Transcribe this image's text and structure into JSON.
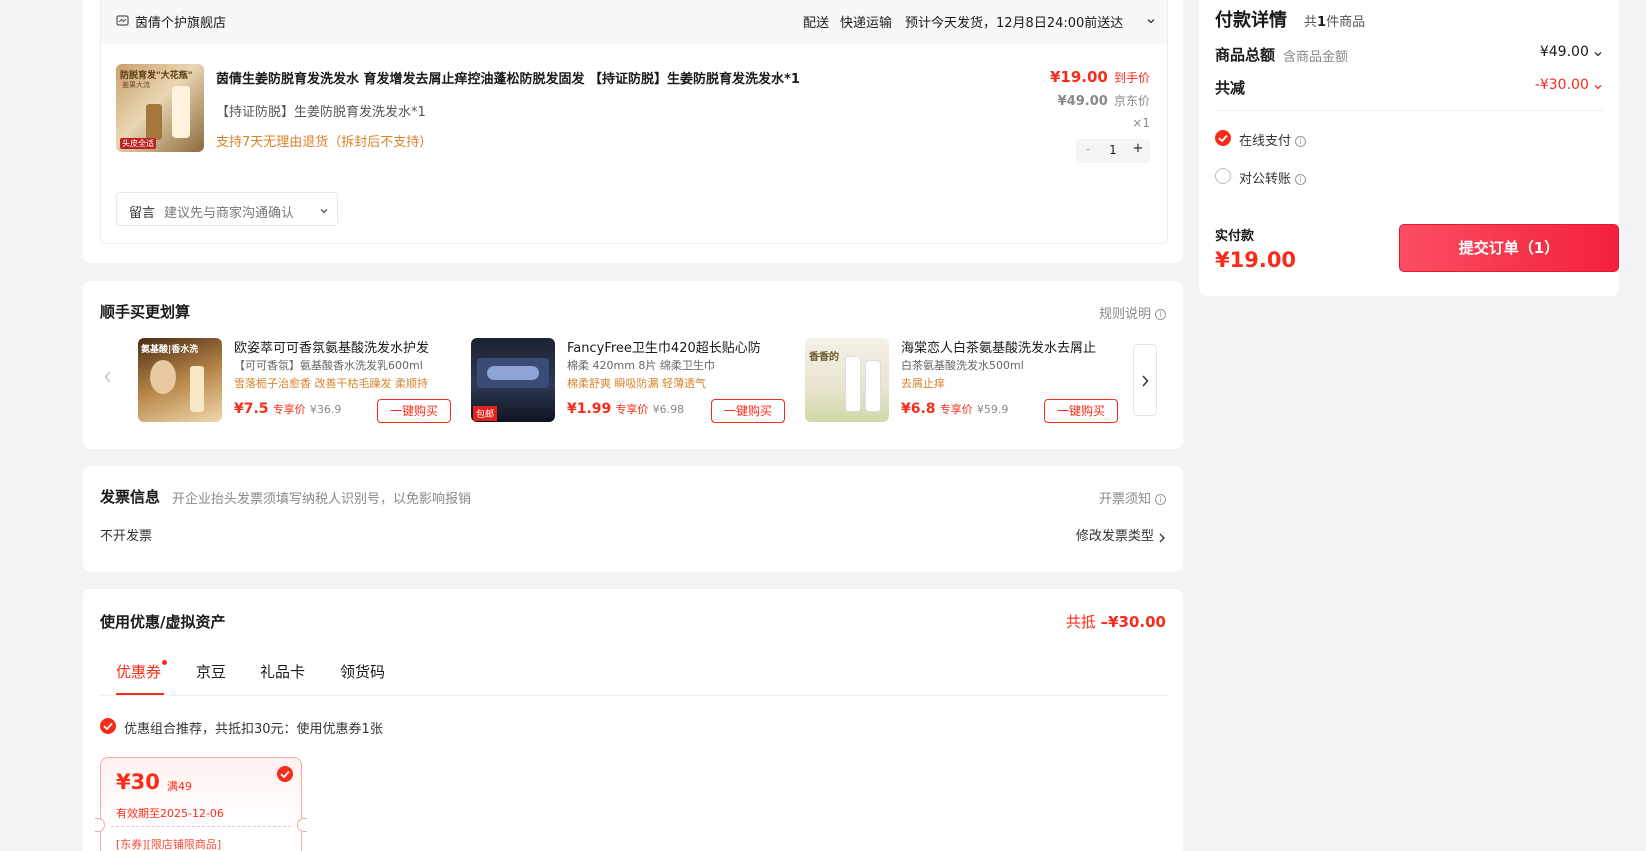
{
  "store": {
    "name": "茵倩个护旗舰店",
    "delivery_label": "配送",
    "delivery_method": "快递运输",
    "delivery_estimate": "预计今天发货，12月8日24:00前送达"
  },
  "product": {
    "thumb_text_top": "防脱育发\"大花瓶\"",
    "thumb_text_sub": "姜果大流",
    "thumb_text_bottom": "头皮全适",
    "title": "茵倩生姜防脱育发洗发水 育发增发去屑止痒控油蓬松防脱发固发 【持证防脱】生姜防脱育发洗发水*1",
    "spec": "【持证防脱】生姜防脱育发洗发水*1",
    "return_policy": "支持7天无理由退货（拆封后不支持）",
    "price_final": "¥19.00",
    "price_final_label": "到手价",
    "price_jd": "¥49.00",
    "price_jd_label": "京东价",
    "qty_label": "×1",
    "qty_minus": "-",
    "qty_value": "1",
    "qty_plus": "+"
  },
  "message": {
    "label": "留言",
    "placeholder": "建议先与商家沟通确认"
  },
  "bundle": {
    "title": "顺手买更划算",
    "rules_label": "规则说明",
    "items": [
      {
        "name": "欧姿萃可可香氛氨基酸洗发水护发",
        "spec": "【可可香氛】氨基酸香水洗发乳600ml",
        "tags": "雪落栀子治愈香 改善干枯毛躁发 柔顺持",
        "price": "¥7.5",
        "price_label": "专享价",
        "orig": "¥36.9",
        "button": "一键购买",
        "thumb_text": "氨基酸|香水洗"
      },
      {
        "name": "FancyFree卫生巾420超长贴心防",
        "spec": "棉柔 420mm 8片 绵柔卫生巾",
        "tags": "棉柔舒爽 瞬吸防漏 轻薄透气",
        "price": "¥1.99",
        "price_label": "专享价",
        "orig": "¥6.98",
        "button": "一键购买",
        "thumb_text": "包邮"
      },
      {
        "name": "海棠恋人白茶氨基酸洗发水去屑止",
        "spec": "白茶氨基酸洗发水500ml",
        "tags": "去屑止痒",
        "price": "¥6.8",
        "price_label": "专享价",
        "orig": "¥59.9",
        "button": "一键购买",
        "thumb_text": "香香的"
      }
    ]
  },
  "invoice": {
    "title": "发票信息",
    "hint": "开企业抬头发票须填写纳税人识别号，以免影响报销",
    "notice_label": "开票须知",
    "value": "不开发票",
    "modify_label": "修改发票类型"
  },
  "discount": {
    "title": "使用优惠/虚拟资产",
    "total_label": "共抵",
    "total_value": "–¥30.00",
    "tabs": [
      "优惠券",
      "京豆",
      "礼品卡",
      "领货码"
    ],
    "recommend": "优惠组合推荐，共抵扣30元：使用优惠券1张",
    "coupon": {
      "amount": "¥30",
      "condition": "满49",
      "expiry": "有效期至2025-12-06",
      "scope": "[东券][限店铺限商品]"
    }
  },
  "payment": {
    "title": "付款详情",
    "count_prefix": "共",
    "count_num": "1",
    "count_suffix": "件商品",
    "total_label": "商品总额",
    "total_hint": "含商品金额",
    "total_value": "¥49.00",
    "discount_label": "共减",
    "discount_value": "-¥30.00",
    "methods": [
      "在线支付",
      "对公转账"
    ],
    "pay_label": "实付款",
    "pay_value": "¥19.00",
    "submit_label": "提交订单（1）"
  },
  "colors": {
    "accent": "#fa2c19",
    "orange": "#d9822b",
    "page_bg": "#f2f3f5"
  }
}
